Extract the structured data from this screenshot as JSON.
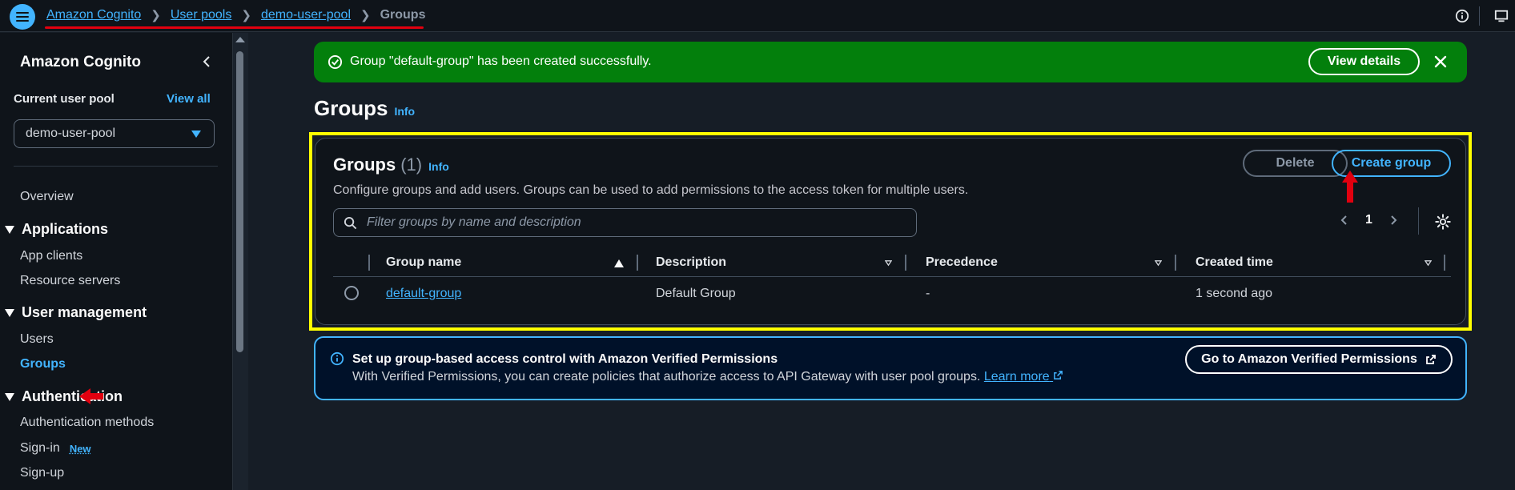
{
  "breadcrumbs": {
    "items": [
      "Amazon Cognito",
      "User pools",
      "demo-user-pool"
    ],
    "current": "Groups"
  },
  "sidebar": {
    "title": "Amazon Cognito",
    "pool_label": "Current user pool",
    "view_all": "View all",
    "selected_pool": "demo-user-pool",
    "overview": "Overview",
    "sections": {
      "applications": {
        "title": "Applications",
        "items": [
          "App clients",
          "Resource servers"
        ]
      },
      "user_management": {
        "title": "User management",
        "items": [
          "Users",
          "Groups"
        ]
      },
      "authentication": {
        "title": "Authentication",
        "items": [
          "Authentication methods",
          "Sign-in",
          "Sign-up"
        ],
        "badge": "New"
      }
    }
  },
  "flash": {
    "message": "Group \"default-group\" has been created successfully.",
    "button": "View details"
  },
  "page": {
    "title": "Groups",
    "info": "Info"
  },
  "groups_table": {
    "title": "Groups",
    "count": "(1)",
    "info": "Info",
    "description": "Configure groups and add users. Groups can be used to add permissions to the access token for multiple users.",
    "delete_button": "Delete",
    "create_button": "Create group",
    "filter_placeholder": "Filter groups by name and description",
    "page_number": "1",
    "columns": [
      "Group name",
      "Description",
      "Precedence",
      "Created time"
    ],
    "rows": [
      {
        "name": "default-group",
        "description": "Default Group",
        "precedence": "-",
        "created": "1 second ago"
      }
    ]
  },
  "alert": {
    "title": "Set up group-based access control with Amazon Verified Permissions",
    "body": "With Verified Permissions, you can create policies that authorize access to API Gateway with user pool groups.",
    "learn_more": "Learn more",
    "button": "Go to Amazon Verified Permissions"
  },
  "colors": {
    "accent": "#42b4ff",
    "success": "#037f0c",
    "highlight": "#ffff00",
    "annotation": "#e1000f"
  }
}
